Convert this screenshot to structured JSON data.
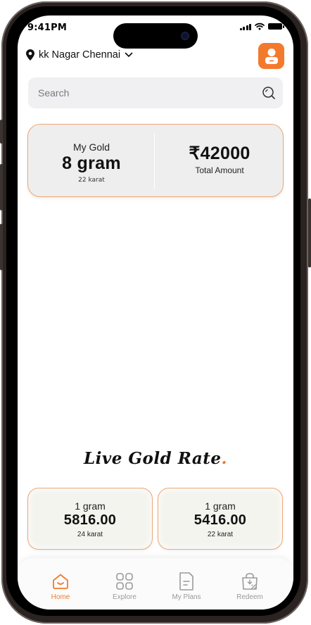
{
  "status_bar": {
    "time": "9:41PM"
  },
  "location": {
    "label": "kk Nagar Chennai"
  },
  "search": {
    "placeholder": "Search"
  },
  "gold_card": {
    "title": "My Gold",
    "weight": "8 gram",
    "karat": "22 karat",
    "amount": "₹42000",
    "amount_label": "Total Amount"
  },
  "live_rate": {
    "title": "Live Gold Rate",
    "dot": ".",
    "cards": [
      {
        "unit": "1 gram",
        "price": "5816.00",
        "karat": "24 karat"
      },
      {
        "unit": "1 gram",
        "price": "5416.00",
        "karat": "22 karat"
      }
    ]
  },
  "nav": {
    "items": [
      {
        "label": "Home",
        "icon": "home-icon",
        "active": true
      },
      {
        "label": "Explore",
        "icon": "grid-icon",
        "active": false
      },
      {
        "label": "My Plans",
        "icon": "document-icon",
        "active": false
      },
      {
        "label": "Redeem",
        "icon": "discount-bag-icon",
        "active": false
      }
    ]
  },
  "colors": {
    "accent": "#f37a2d",
    "card_border": "#f0a777",
    "card_bg": "#eeeeee"
  }
}
